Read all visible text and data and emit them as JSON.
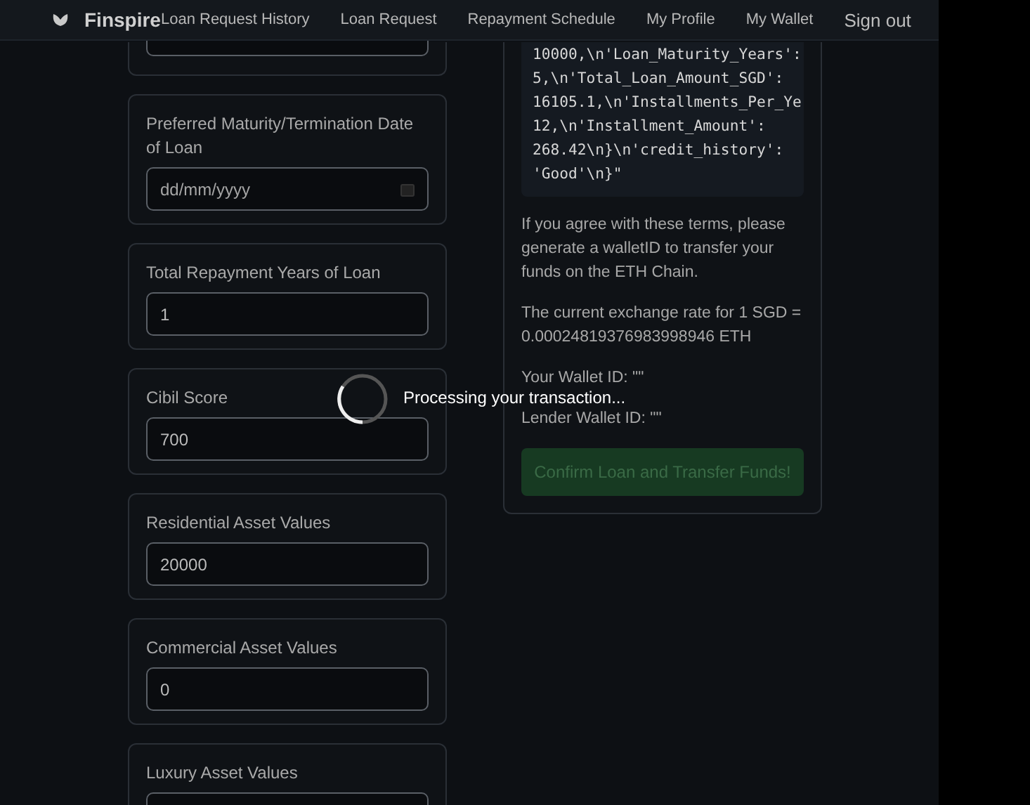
{
  "navbar": {
    "brand": "Finspire",
    "links": [
      "Loan Request History",
      "Loan Request",
      "Repayment Schedule",
      "My Profile",
      "My Wallet"
    ],
    "sign_out": "Sign out"
  },
  "form_fields": [
    {
      "label": "Preferred Maturity/Termination Date of Loan",
      "placeholder": "dd/mm/yyyy",
      "kind": "date"
    },
    {
      "label": "Total Repayment Years of Loan",
      "value": "1",
      "kind": "number"
    },
    {
      "label": "Cibil Score",
      "value": "700",
      "kind": "number"
    },
    {
      "label": "Residential Asset Values",
      "value": "20000",
      "kind": "number"
    },
    {
      "label": "Commercial Asset Values",
      "value": "0",
      "kind": "number"
    },
    {
      "label": "Luxury Asset Values",
      "kind": "number"
    }
  ],
  "terms": {
    "code_lines": [
      "10000,\\n'Loan_Maturity_Years':",
      "5,\\n'Total_Loan_Amount_SGD':",
      "16105.1,\\n'Installments_Per_Ye",
      "12,\\n'Installment_Amount':",
      "268.42\\n}\\n'credit_history':",
      "'Good'\\n}\""
    ],
    "agreement": "If you agree with these terms, please generate a walletID to transfer your funds on the ETH Chain.",
    "exchange_rate": "The current exchange rate for 1 SGD = 0.00024819376983998946 ETH",
    "your_wallet": "Your Wallet ID: \"\"",
    "lender_wallet": "Lender Wallet ID: \"\"",
    "confirm_button": {
      "label": "Confirm Loan and Transfer Funds!",
      "disabled": true
    }
  },
  "overlay": {
    "message": "Processing your transaction..."
  }
}
